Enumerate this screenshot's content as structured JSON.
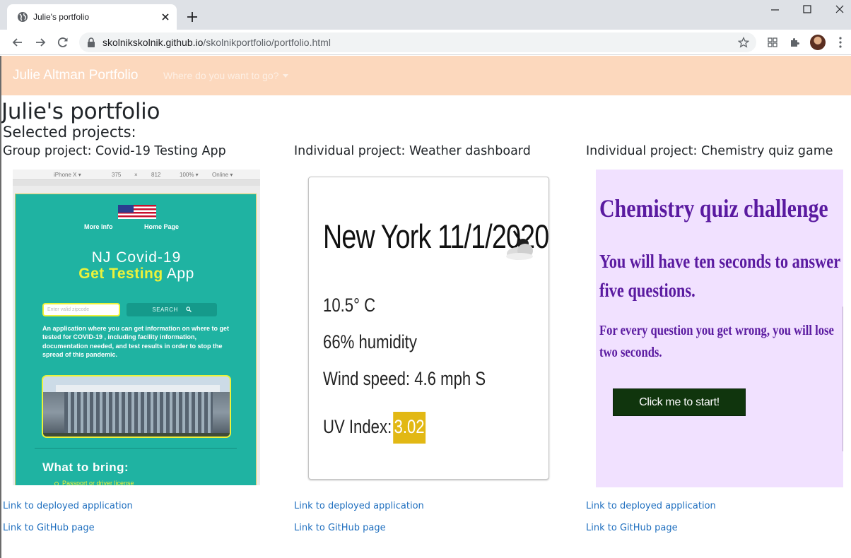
{
  "browser": {
    "tab_title": "Julie's portfolio",
    "url_host": "skolnikskolnik.github.io",
    "url_path": "/skolnikportfolio/portfolio.html"
  },
  "navbar": {
    "brand": "Julie Altman Portfolio",
    "dropdown_label": "Where do you want to go?",
    "background_color": "#fcd8bd"
  },
  "page": {
    "title": "Julie's portfolio",
    "subtitle": "Selected projects:"
  },
  "projects": [
    {
      "title": "Group project: Covid-19 Testing App",
      "deployed_link": "Link to deployed application",
      "github_link": "Link to GitHub page",
      "screenshot": {
        "devtools_bar": [
          "iPhone X ▾",
          "375",
          "×",
          "812",
          "100% ▾",
          "Online ▾"
        ],
        "nav_links": [
          "More Info",
          "Home Page"
        ],
        "title_line1": "NJ Covid-19",
        "title_highlight": "Get Testing",
        "title_rest": " App",
        "input_placeholder": "Enter valid zipcode",
        "search_label": "SEARCH",
        "description": "An application where you can get information on where to get tested for COVID-19 , including facility information, documentation needed, and test results in order to stop the spread of this pandemic.",
        "section_heading": "What to bring:",
        "list_item": "Passport or driver license",
        "accent_color": "#1fb3a2"
      }
    },
    {
      "title": "Individual project: Weather dashboard",
      "deployed_link": "Link to deployed application",
      "github_link": "Link to GitHub page",
      "screenshot": {
        "city_date": "New York 11/1/2020",
        "weather_icon": "cloud-icon",
        "temperature": "10.5° C",
        "humidity": "66% humidity",
        "wind": "Wind speed: 4.6 mph S",
        "uv_label": "UV Index:",
        "uv_value": "3.02",
        "uv_color": "#e2b814"
      }
    },
    {
      "title": "Individual project: Chemistry quiz game",
      "deployed_link": "Link to deployed application",
      "github_link": "Link to GitHub page",
      "screenshot": {
        "heading": "Chemistry quiz challenge",
        "paragraph1": "You will have ten seconds to answer five questions.",
        "paragraph2": "For every question you get wrong, you will lose two seconds.",
        "start_button": "Click me to start!",
        "text_color": "#5a1aa0",
        "background_color": "#f1e1ff"
      }
    }
  ]
}
